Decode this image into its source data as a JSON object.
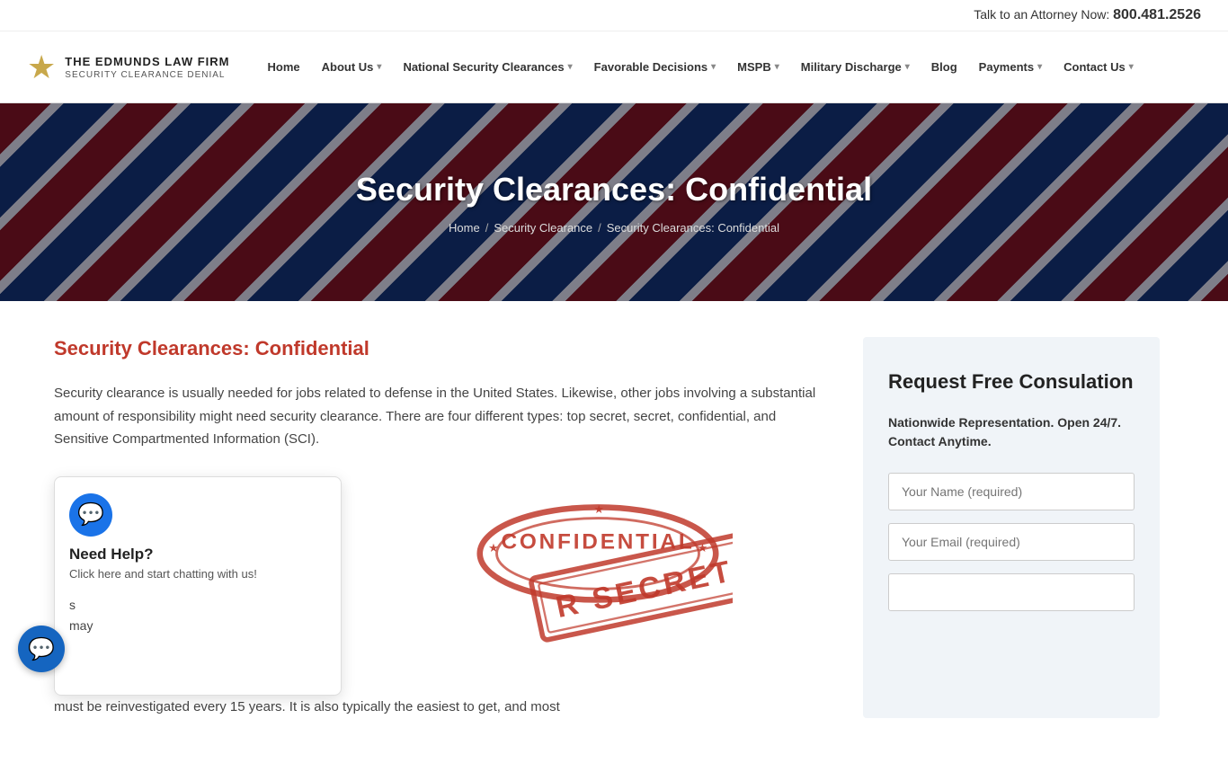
{
  "topbar": {
    "cta_prefix": "Talk to an Attorney Now:",
    "phone": "800.481.2526"
  },
  "logo": {
    "firm_name": "THE EDMUNDS LAW FIRM",
    "firm_sub": "SECURITY CLEARANCE DENIAL",
    "star_symbol": "★"
  },
  "nav": {
    "items": [
      {
        "label": "Home",
        "has_dropdown": false
      },
      {
        "label": "About Us",
        "has_dropdown": true
      },
      {
        "label": "National Security Clearances",
        "has_dropdown": true
      },
      {
        "label": "Favorable Decisions",
        "has_dropdown": true
      },
      {
        "label": "MSPB",
        "has_dropdown": true
      },
      {
        "label": "Military Discharge",
        "has_dropdown": true
      },
      {
        "label": "Blog",
        "has_dropdown": false
      },
      {
        "label": "Payments",
        "has_dropdown": true
      },
      {
        "label": "Contact Us",
        "has_dropdown": true
      }
    ]
  },
  "hero": {
    "title": "Security Clearances: Confidential",
    "breadcrumb": [
      {
        "label": "Home",
        "link": true
      },
      {
        "label": "Security Clearance",
        "link": true
      },
      {
        "label": "Security Clearances: Confidential",
        "link": false
      }
    ]
  },
  "content": {
    "title": "Security Clearances: Confidential",
    "intro": "Security clearance is usually needed for jobs related to defense in the United States. Likewise, other jobs involving a substantial amount of responsibility might need security clearance. There are four different types: top secret, secret, confidential, and Sensitive Compartmented Information (SCI).",
    "partial_text": "must be reinvestigated every 15 years. It is also typically the easiest to get, and most"
  },
  "chat_popup": {
    "heading": "Need Help?",
    "subtext": "Click here and start chatting with us!",
    "bubble_symbol": "💬"
  },
  "stamp": {
    "lines": [
      "CONFIDENTIAL",
      "SECRET"
    ],
    "accent_color": "#c0392b"
  },
  "sidebar": {
    "title": "Request Free Consulation",
    "subtitle": "Nationwide Representation. Open 24/7. Contact Anytime.",
    "fields": [
      {
        "placeholder": "Your Name (required)",
        "type": "text"
      },
      {
        "placeholder": "Your Email (required)",
        "type": "email"
      },
      {
        "placeholder": "",
        "type": "text"
      }
    ]
  },
  "chat_widget": {
    "symbol": "💬"
  }
}
